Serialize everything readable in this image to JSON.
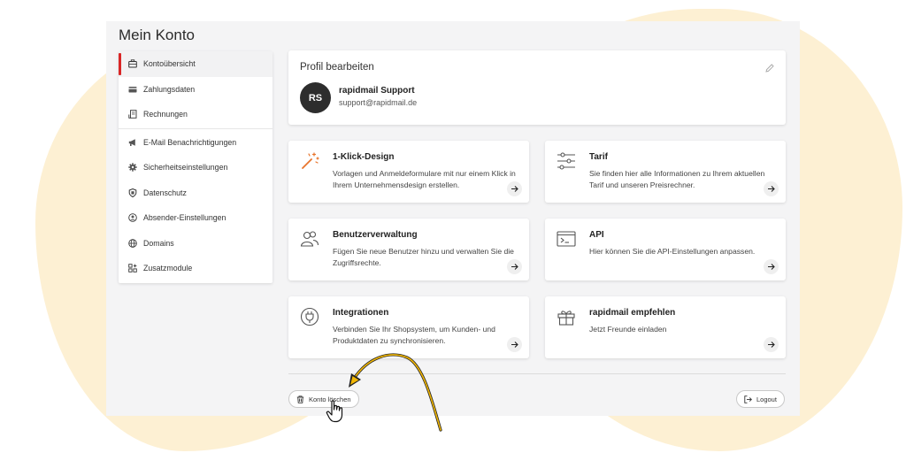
{
  "page": {
    "title": "Mein Konto"
  },
  "sidebar": {
    "items": [
      {
        "label": "Kontoübersicht",
        "icon": "briefcase-icon",
        "active": true
      },
      {
        "label": "Zahlungsdaten",
        "icon": "credit-card-icon"
      },
      {
        "label": "Rechnungen",
        "icon": "invoice-icon"
      },
      {
        "label": "E-Mail Benachrichtigungen",
        "icon": "megaphone-icon"
      },
      {
        "label": "Sicherheitseinstellungen",
        "icon": "gear-icon"
      },
      {
        "label": "Datenschutz",
        "icon": "shield-icon"
      },
      {
        "label": "Absender-Einstellungen",
        "icon": "user-circle-icon"
      },
      {
        "label": "Domains",
        "icon": "globe-icon"
      },
      {
        "label": "Zusatzmodule",
        "icon": "modules-icon"
      }
    ]
  },
  "profile": {
    "title": "Profil bearbeiten",
    "initials": "RS",
    "name": "rapidmail Support",
    "email": "support@rapidmail.de"
  },
  "cards": [
    {
      "title": "1-Klick-Design",
      "desc": "Vorlagen und Anmeldeformulare mit nur einem Klick in Ihrem Unternehmensdesign erstellen.",
      "icon": "magic-wand-icon"
    },
    {
      "title": "Tarif",
      "desc": "Sie finden hier alle Informationen zu Ihrem aktuellen Tarif und unseren Preisrechner.",
      "icon": "sliders-icon"
    },
    {
      "title": "Benutzerverwaltung",
      "desc": "Fügen Sie neue Benutzer hinzu und verwalten Sie die Zugriffsrechte.",
      "icon": "users-icon"
    },
    {
      "title": "API",
      "desc": "Hier können Sie die API-Einstellungen anpassen.",
      "icon": "terminal-icon"
    },
    {
      "title": "Integrationen",
      "desc": "Verbinden Sie Ihr Shopsystem, um Kunden- und Produktdaten zu synchronisieren.",
      "icon": "plug-icon"
    },
    {
      "title": "rapidmail empfehlen",
      "desc": "Jetzt Freunde einladen",
      "icon": "gift-icon"
    }
  ],
  "footer": {
    "delete_label": "Konto löschen",
    "logout_label": "Logout"
  },
  "colors": {
    "accent_red": "#d92626",
    "accent_orange": "#e8742c",
    "background_blob": "#fdf0d3",
    "annotation_arrow": "#e8a400"
  }
}
